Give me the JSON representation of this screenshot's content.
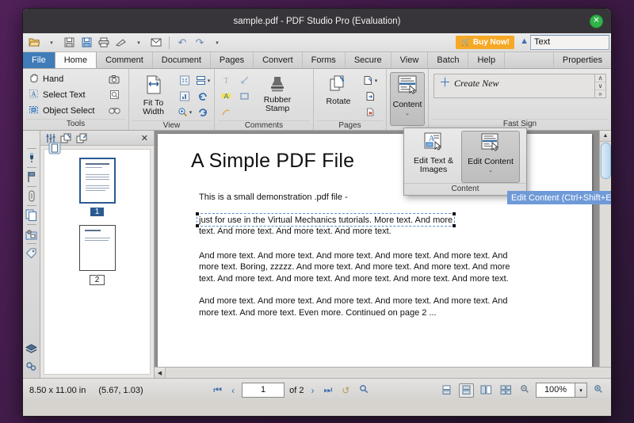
{
  "window": {
    "title": "sample.pdf - PDF Studio Pro (Evaluation)",
    "close_label": "✕"
  },
  "quickbar": {
    "items": [
      {
        "name": "open-file",
        "glyph": "📂"
      },
      {
        "name": "open-dropdown",
        "glyph": "▾"
      },
      {
        "name": "save",
        "glyph": "💾"
      },
      {
        "name": "save-as",
        "glyph": "💾"
      },
      {
        "name": "print",
        "glyph": "🖨"
      },
      {
        "name": "scan",
        "glyph": "✒"
      },
      {
        "name": "scan-dropdown",
        "glyph": "▾"
      },
      {
        "name": "email",
        "glyph": "✉"
      },
      {
        "name": "undo",
        "glyph": "↶"
      },
      {
        "name": "redo",
        "glyph": "↷"
      },
      {
        "name": "history-dropdown",
        "glyph": "▾"
      }
    ],
    "buy_now_label": "Buy Now!",
    "collapse_glyph": "▲",
    "text_field_value": "Text",
    "text_field_placeholder": "Text"
  },
  "tabs": [
    {
      "label": "File",
      "state": "file"
    },
    {
      "label": "Home",
      "state": "active"
    },
    {
      "label": "Comment",
      "state": ""
    },
    {
      "label": "Document",
      "state": ""
    },
    {
      "label": "Pages",
      "state": ""
    },
    {
      "label": "Convert",
      "state": ""
    },
    {
      "label": "Forms",
      "state": ""
    },
    {
      "label": "Secure",
      "state": ""
    },
    {
      "label": "View",
      "state": ""
    },
    {
      "label": "Batch",
      "state": ""
    },
    {
      "label": "Help",
      "state": ""
    },
    {
      "label": "Properties",
      "state": "right"
    }
  ],
  "ribbon": {
    "tools": {
      "group_label": "Tools",
      "hand_label": "Hand",
      "select_text_label": "Select Text",
      "object_select_label": "Object Select",
      "snapshot_name": "snapshot-icon",
      "loupe_name": "loupe-icon",
      "pan_zoom_name": "pan-and-zoom-icon"
    },
    "view": {
      "group_label": "View",
      "fit_to_width_label": "Fit To Width",
      "fit_page_name": "fit-page-icon",
      "fit_visible_name": "fit-visible-icon",
      "zoom_label": "zoom-icon",
      "split_name": "split-view-icon",
      "rotate_ccw_name": "rotate-view-ccw-icon",
      "rotate_cw_name": "rotate-view-cw-icon"
    },
    "comments": {
      "group_label": "Comments",
      "rubber_stamp_label": "Rubber Stamp",
      "text_box_name": "text-box-icon",
      "arrow_name": "arrow-annotation-icon",
      "highlight_name": "highlight-icon",
      "rectangle_name": "rectangle-icon",
      "pencil_name": "pencil-icon"
    },
    "pages": {
      "group_label": "Pages",
      "rotate_label": "Rotate",
      "insert_pages_name": "insert-pages-icon",
      "extract_pages_name": "extract-pages-icon",
      "delete_pages_name": "delete-pages-icon"
    },
    "content": {
      "group_label": "Content",
      "button_label": "Content",
      "caret": "⌄"
    },
    "fast_sign": {
      "group_label": "Fast Sign",
      "create_new_label": "Create New",
      "plus": "＋",
      "scroll_up": "∧",
      "scroll_down": "∨",
      "scroll_end": "»"
    }
  },
  "content_popup": {
    "group_label": "Content",
    "edit_text_images_label": "Edit Text & Images",
    "edit_content_label": "Edit Content",
    "caret": "⌄"
  },
  "tooltip": {
    "text": "Edit Content  (Ctrl+Shift+E)"
  },
  "rail": {
    "items": [
      {
        "name": "thumbnails-icon",
        "glyph": "⬜"
      },
      {
        "name": "signatures-icon",
        "glyph": "✎"
      },
      {
        "name": "bookmarks-icon",
        "glyph": "⚑"
      },
      {
        "name": "attachments-icon",
        "glyph": "📎"
      },
      {
        "name": "pages-panel-icon",
        "glyph": "🗐"
      },
      {
        "name": "stamps-icon",
        "glyph": "🖼"
      },
      {
        "name": "tags-icon",
        "glyph": "🏷"
      },
      {
        "name": "layers-icon",
        "glyph": "☷"
      },
      {
        "name": "links-icon",
        "glyph": "🔗"
      }
    ]
  },
  "thumbnail_panel": {
    "header_icons": [
      {
        "name": "thumbnail-settings-icon",
        "glyph": "⦀"
      },
      {
        "name": "rotate-pages-left-icon",
        "glyph": "↺"
      },
      {
        "name": "rotate-pages-right-icon",
        "glyph": "↻"
      }
    ],
    "close_glyph": "✕",
    "pages": [
      {
        "number": "1",
        "selected": true
      },
      {
        "number": "2",
        "selected": false
      }
    ]
  },
  "document": {
    "heading": "A Simple PDF File",
    "paragraph1": "This is a small demonstration .pdf file -",
    "selected_line": "just for use in the Virtual Mechanics tutorials. More text. And more",
    "paragraph2_rest": "text. And more text. And more text. And more text.",
    "paragraph3": "And more text. And more text. And more text. And more text. And more text. And more text. Boring, zzzzz. And more text. And more text. And more text. And more text. And more text. And more text. And more text. And more text. And more text.",
    "paragraph4": "And more text. And more text. And more text. And more text. And more text. And more text. And more text. Even more. Continued on page 2 ..."
  },
  "status": {
    "page_size": "8.50 x 11.00 in",
    "cursor_position": "(5.67, 1.03)",
    "first_page_glyph": "⏮",
    "prev_page_glyph": "‹",
    "page_value": "1",
    "page_count_label": "of 2",
    "next_page_glyph": "›",
    "last_page_glyph": "⏭",
    "prev_view_glyph": "↺",
    "next_view_glyph": "↻",
    "view_modes": [
      {
        "name": "single-page-mode",
        "glyph": "⌸",
        "active": false
      },
      {
        "name": "continuous-mode",
        "glyph": "⌸",
        "active": true
      },
      {
        "name": "facing-mode",
        "glyph": "⌸",
        "active": false
      },
      {
        "name": "facing-continuous-mode",
        "glyph": "⌸",
        "active": false
      }
    ],
    "zoom_out_glyph": "⊖",
    "zoom_value": "100%",
    "zoom_dropdown_glyph": "▾",
    "zoom_in_glyph": "⊕"
  },
  "colors": {
    "accent_blue": "#3f7cb8",
    "buy_now_orange": "#f7a926",
    "tooltip_blue": "#6f9ad8",
    "close_green": "#31b349",
    "desktop_purple": "#4a1d50"
  }
}
